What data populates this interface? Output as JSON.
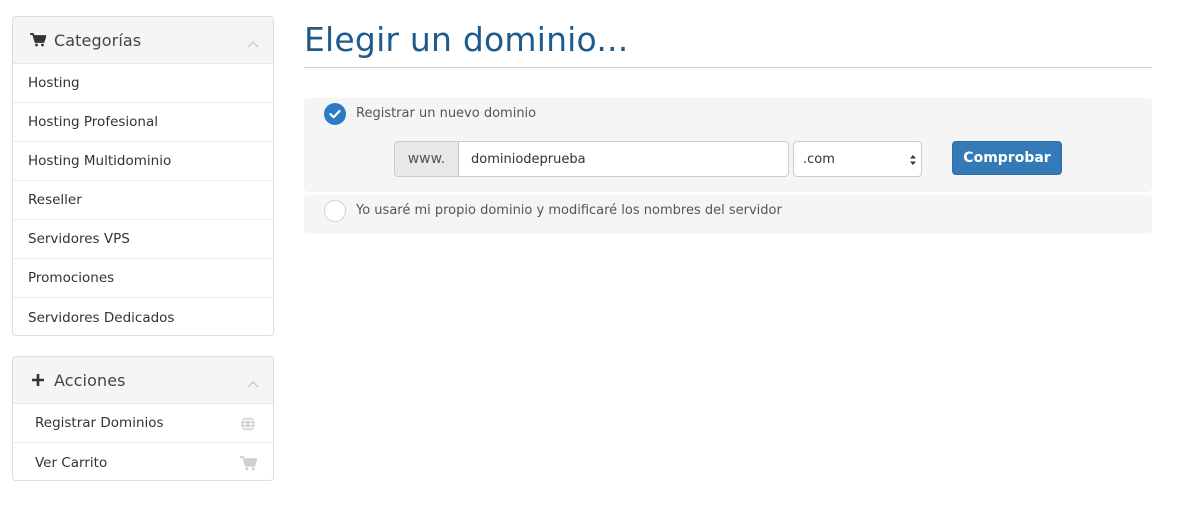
{
  "sidebar": {
    "categories": {
      "title": "Categorías",
      "icon": "cart-icon",
      "items": [
        {
          "label": "Hosting"
        },
        {
          "label": "Hosting Profesional"
        },
        {
          "label": "Hosting Multidominio"
        },
        {
          "label": "Reseller"
        },
        {
          "label": "Servidores VPS"
        },
        {
          "label": "Promociones"
        },
        {
          "label": "Servidores Dedicados"
        }
      ]
    },
    "actions": {
      "title": "Acciones",
      "icon": "plus-icon",
      "items": [
        {
          "label": "Registrar Dominios",
          "icon": "globe-icon"
        },
        {
          "label": "Ver Carrito",
          "icon": "cart-icon"
        }
      ]
    }
  },
  "main": {
    "title": "Elegir un dominio...",
    "options": [
      {
        "label": "Registrar un nuevo dominio",
        "checked": true
      },
      {
        "label": "Yo usaré mi propio dominio y modificaré los nombres del servidor",
        "checked": false
      }
    ],
    "domain_form": {
      "prefix": "www.",
      "value": "dominiodeprueba",
      "tld": ".com",
      "button_label": "Comprobar"
    }
  },
  "colors": {
    "title": "#1e5b8c",
    "accent": "#337ab7",
    "radio_checked": "#2d7bc4"
  }
}
